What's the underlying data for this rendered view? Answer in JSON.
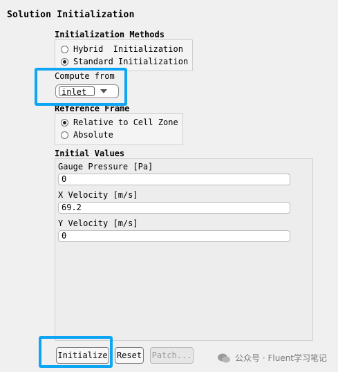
{
  "panel": {
    "title": "Solution Initialization"
  },
  "init_methods": {
    "title": "Initialization Methods",
    "options": [
      "Hybrid  Initialization",
      "Standard Initialization"
    ],
    "selected": 1
  },
  "compute_from": {
    "label": "Compute from",
    "value": "inlet"
  },
  "reference_frame": {
    "title": "Reference Frame",
    "options": [
      "Relative to Cell Zone",
      "Absolute"
    ],
    "selected": 0
  },
  "initial_values": {
    "title": "Initial Values",
    "fields": [
      {
        "label": "Gauge Pressure [Pa]",
        "value": "0"
      },
      {
        "label": "X Velocity [m/s]",
        "value": "69.2"
      },
      {
        "label": "Y Velocity [m/s]",
        "value": "0"
      }
    ]
  },
  "buttons": {
    "initialize": "Initialize",
    "reset": "Reset",
    "patch": "Patch..."
  },
  "watermark": {
    "text": "公众号 · Fluent学习笔记"
  },
  "colors": {
    "highlight": "#0ea5f5"
  }
}
